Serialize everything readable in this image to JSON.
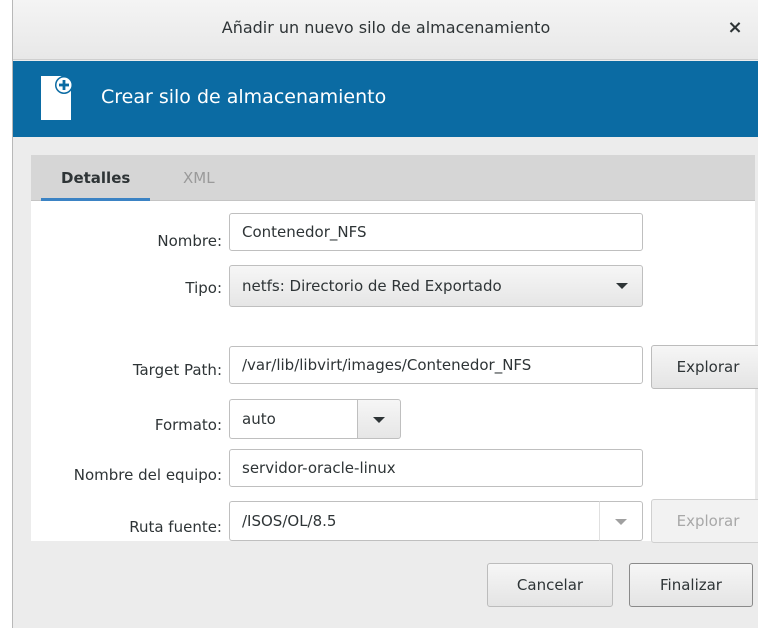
{
  "window": {
    "title": "Añadir un nuevo silo de almacenamiento",
    "close_glyph": "×"
  },
  "banner": {
    "heading": "Crear silo de almacenamiento",
    "icon": "new-document-plus-icon",
    "color": "#0b6ba3"
  },
  "tabs": [
    {
      "label": "Detalles",
      "active": true
    },
    {
      "label": "XML",
      "active": false
    }
  ],
  "form": {
    "nombre": {
      "label": "Nombre:",
      "value": "Contenedor_NFS"
    },
    "tipo": {
      "label": "Tipo:",
      "value": "netfs: Directorio de Red Exportado"
    },
    "target_path": {
      "label": "Target Path:",
      "value": "/var/lib/libvirt/images/Contenedor_NFS",
      "browse": "Explorar"
    },
    "formato": {
      "label": "Formato:",
      "value": "auto"
    },
    "equipo": {
      "label": "Nombre del equipo:",
      "value": "servidor-oracle-linux"
    },
    "ruta_fuente": {
      "label": "Ruta fuente:",
      "value": "/ISOS/OL/8.5",
      "browse": "Explorar"
    }
  },
  "actions": {
    "cancel": "Cancelar",
    "finish": "Finalizar"
  }
}
